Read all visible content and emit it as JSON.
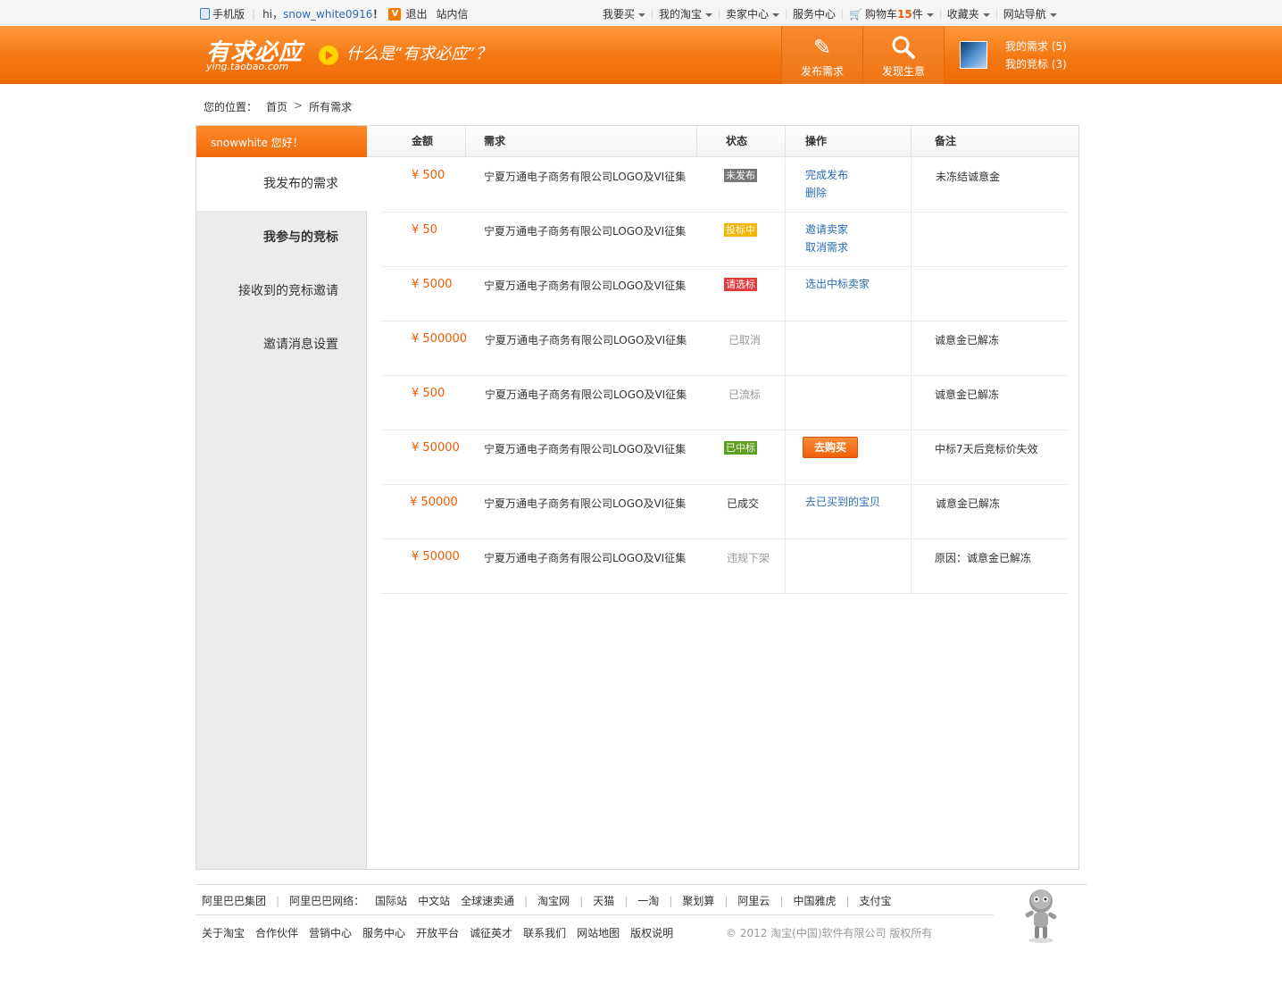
{
  "topbar": {
    "mobile": "手机版",
    "hi": "hi，",
    "username": "snow_white0916",
    "exclaim": "！",
    "logout": "退出",
    "messages": "站内信",
    "menus": [
      "我要买",
      "我的淘宝",
      "卖家中心",
      "服务中心"
    ],
    "cart_label": "购物车",
    "cart_count": "15",
    "cart_unit": "件",
    "favorites": "收藏夹",
    "sitenav": "网站导航"
  },
  "header": {
    "logo": "有求必应",
    "logo_sub": "ying.taobao.com",
    "slogan": "什么是“有求必应”？",
    "post_label": "发布需求",
    "find_label": "发现生意",
    "my_requests": "我的需求 (5)",
    "my_bids": "我的竞标 (3)"
  },
  "breadcrumb": {
    "prefix": "您的位置：",
    "home": "首页",
    "current": "所有需求"
  },
  "sidebar": {
    "greeting": "snowwhite  您好！",
    "items": [
      "我发布的需求",
      "我参与的竞标",
      "接收到的竞标邀请",
      "邀请消息设置"
    ]
  },
  "table": {
    "headers": [
      "金额",
      "需求",
      "状态",
      "操作",
      "备注"
    ],
    "rows": [
      {
        "amount": "¥ 500",
        "request": "宁夏万通电子商务有限公司LOGO及VI征集",
        "status": "未发布",
        "ops": [
          "完成发布",
          "删除"
        ],
        "note": "未冻结诚意金"
      },
      {
        "amount": "¥ 50",
        "request": "宁夏万通电子商务有限公司LOGO及VI征集",
        "status": "投标中",
        "ops": [
          "邀请卖家",
          "取消需求"
        ],
        "note": ""
      },
      {
        "amount": "¥ 5000",
        "request": "宁夏万通电子商务有限公司LOGO及VI征集",
        "status": "请选标",
        "ops": [
          "选出中标卖家"
        ],
        "note": ""
      },
      {
        "amount": "¥ 500000",
        "request": "宁夏万通电子商务有限公司LOGO及VI征集",
        "status": "已取消",
        "ops": [],
        "note": "诚意金已解冻"
      },
      {
        "amount": "¥ 500",
        "request": "宁夏万通电子商务有限公司LOGO及VI征集",
        "status": "已流标",
        "ops": [],
        "note": "诚意金已解冻"
      },
      {
        "amount": "¥ 50000",
        "request": "宁夏万通电子商务有限公司LOGO及VI征集",
        "status": "已中标",
        "ops": [],
        "buy_button": "去购买",
        "note": "中标7天后竞标价失效"
      },
      {
        "amount": "¥ 50000",
        "request": "宁夏万通电子商务有限公司LOGO及VI征集",
        "status": "已成交",
        "ops": [
          "去已买到的宝贝"
        ],
        "note": "诚意金已解冻"
      },
      {
        "amount": "¥ 50000",
        "request": "宁夏万通电子商务有限公司LOGO及VI征集",
        "status": "违规下架",
        "ops": [],
        "note": "原因：诚意金已解冻"
      }
    ]
  },
  "footer": {
    "row1": [
      "阿里巴巴集团",
      "阿里巴巴网络：",
      "国际站",
      "中文站",
      "全球速卖通",
      "淘宝网",
      "天猫",
      "一淘",
      "聚划算",
      "阿里云",
      "中国雅虎",
      "支付宝"
    ],
    "row2": [
      "关于淘宝",
      "合作伙伴",
      "营销中心",
      "服务中心",
      "开放平台",
      "诚征英才",
      "联系我们",
      "网站地图",
      "版权说明"
    ],
    "copyright": "© 2012 淘宝(中国)软件有限公司 版权所有"
  },
  "colors": {
    "accent": "#f07a00",
    "link": "#2b6cb3",
    "status_unpublished": "#777777",
    "status_bidding": "#f5b400",
    "status_select": "#e33b3b",
    "status_won": "#5aa01c"
  }
}
